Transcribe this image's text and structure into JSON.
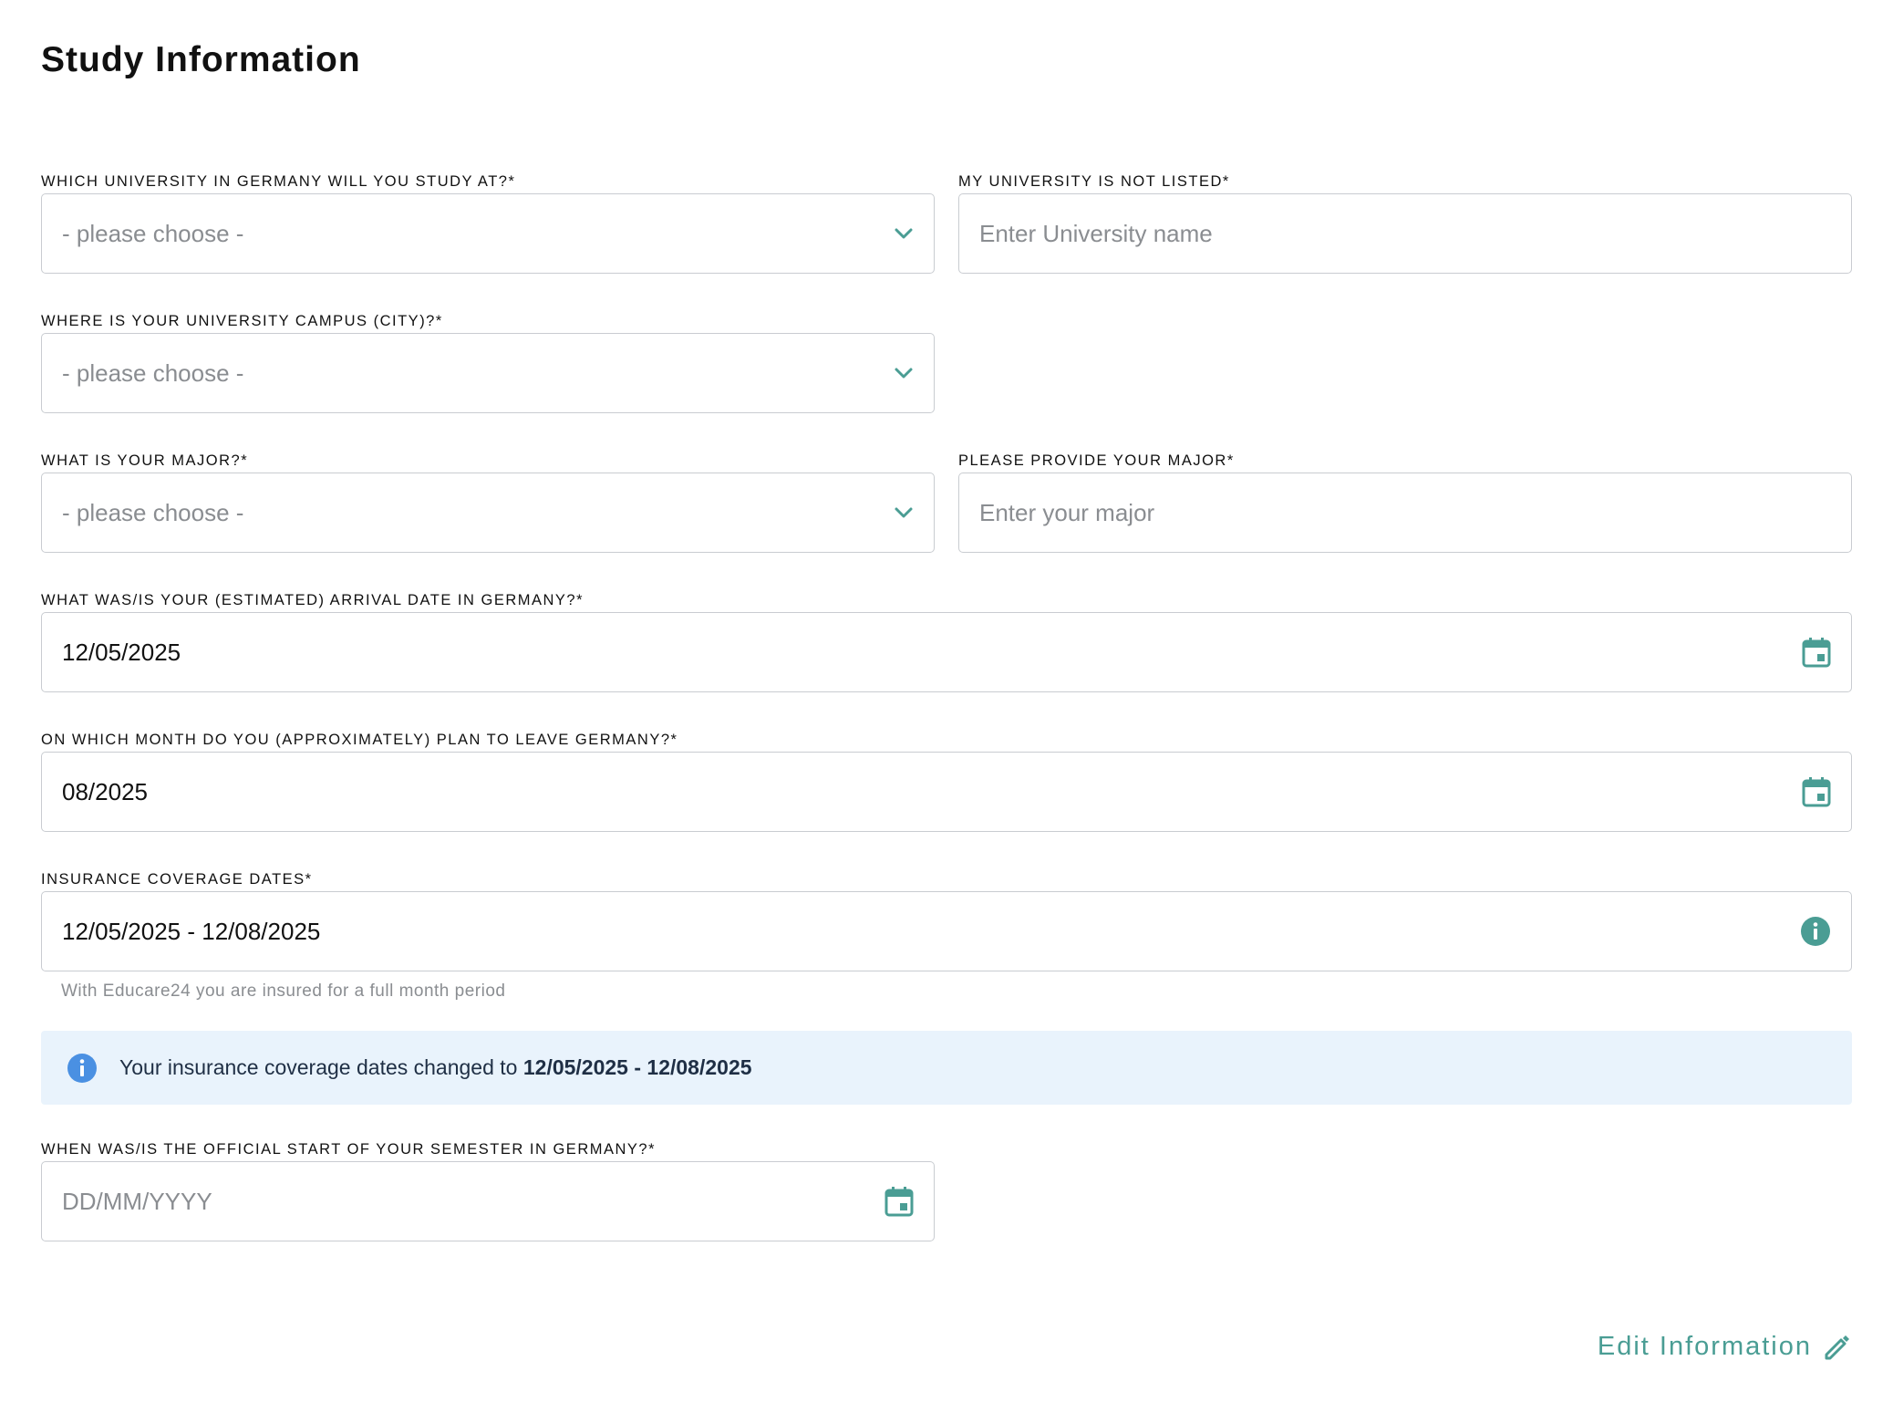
{
  "page": {
    "title": "Study Information"
  },
  "colors": {
    "accent": "#4a9d94",
    "info_blue": "#4a90e2",
    "banner_bg": "#e9f3fc",
    "border": "#c9ccd1"
  },
  "fields": {
    "university": {
      "label": "WHICH UNIVERSITY IN GERMANY WILL YOU STUDY AT?*",
      "placeholder": "- please choose -",
      "icon": "chevron-down-icon"
    },
    "university_other": {
      "label": "MY UNIVERSITY IS NOT LISTED*",
      "placeholder": "Enter University name"
    },
    "campus_city": {
      "label": "WHERE IS YOUR UNIVERSITY CAMPUS (CITY)?*",
      "placeholder": "- please choose -",
      "icon": "chevron-down-icon"
    },
    "major": {
      "label": "WHAT IS YOUR MAJOR?*",
      "placeholder": "- please choose -",
      "icon": "chevron-down-icon"
    },
    "major_other": {
      "label": "PLEASE PROVIDE YOUR MAJOR*",
      "placeholder": "Enter your major"
    },
    "arrival_date": {
      "label": "WHAT WAS/IS YOUR (ESTIMATED) ARRIVAL DATE IN GERMANY?*",
      "value": "12/05/2025",
      "icon": "calendar-icon"
    },
    "leave_month": {
      "label": "ON WHICH MONTH DO YOU (APPROXIMATELY) PLAN TO LEAVE GERMANY?*",
      "value": "08/2025",
      "icon": "calendar-icon"
    },
    "coverage_dates": {
      "label": "INSURANCE COVERAGE DATES*",
      "value": "12/05/2025 - 12/08/2025",
      "helper": "With Educare24 you are insured for a full month period",
      "icon": "info-icon"
    },
    "semester_start": {
      "label": "WHEN WAS/IS THE OFFICIAL START OF YOUR SEMESTER IN GERMANY?*",
      "placeholder": "DD/MM/YYYY",
      "icon": "calendar-icon"
    }
  },
  "banner": {
    "text": "Your insurance coverage dates changed to ",
    "dates": "12/05/2025 - 12/08/2025",
    "icon": "info-icon"
  },
  "actions": {
    "edit_label": "Edit Information",
    "edit_icon": "pencil-icon"
  }
}
